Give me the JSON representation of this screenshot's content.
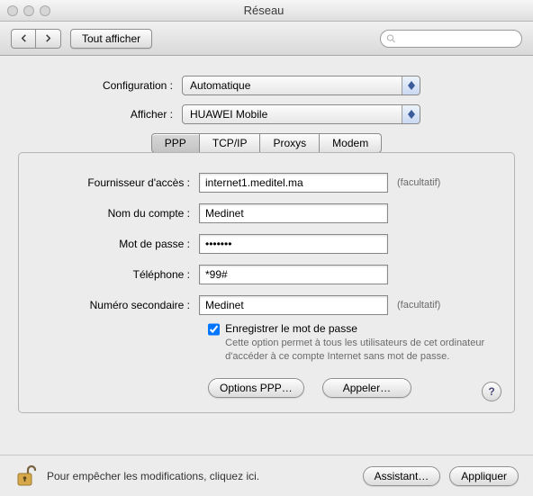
{
  "window": {
    "title": "Réseau"
  },
  "toolbar": {
    "show_all": "Tout afficher",
    "search_placeholder": ""
  },
  "config_row": {
    "label": "Configuration :",
    "value": "Automatique"
  },
  "show_row": {
    "label": "Afficher :",
    "value": "HUAWEI Mobile"
  },
  "tabs": {
    "ppp": "PPP",
    "tcpip": "TCP/IP",
    "proxys": "Proxys",
    "modem": "Modem"
  },
  "form": {
    "provider": {
      "label": "Fournisseur d'accès :",
      "value": "internet1.meditel.ma",
      "hint": "(facultatif)"
    },
    "account": {
      "label": "Nom du compte :",
      "value": "Medinet"
    },
    "password": {
      "label": "Mot de passe :",
      "value": "•••••••"
    },
    "phone": {
      "label": "Téléphone :",
      "value": "*99#"
    },
    "secondary": {
      "label": "Numéro secondaire :",
      "value": "Medinet",
      "hint": "(facultatif)"
    },
    "save_pw": {
      "label": "Enregistrer le mot de passe",
      "sub": "Cette option permet à tous les utilisateurs de cet ordinateur d'accéder à ce compte Internet sans mot de passe."
    },
    "ppp_opts": "Options PPP…",
    "call": "Appeler…"
  },
  "footer": {
    "lock_msg": "Pour empêcher les modifications, cliquez ici.",
    "assistant": "Assistant…",
    "apply": "Appliquer"
  },
  "help": "?"
}
